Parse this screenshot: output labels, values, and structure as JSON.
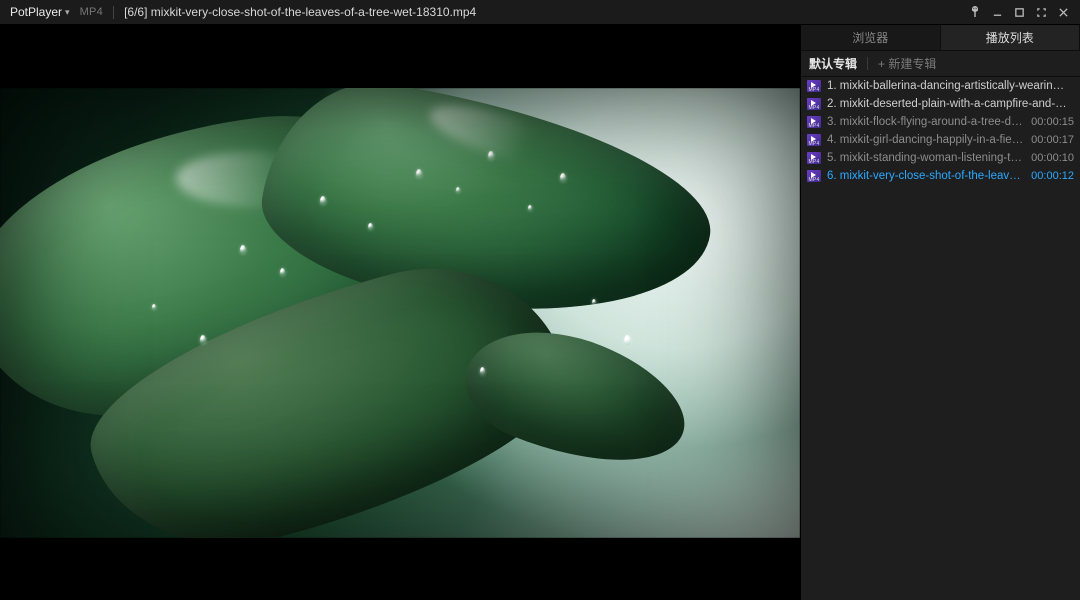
{
  "titlebar": {
    "app_name": "PotPlayer",
    "format_badge": "MP4",
    "file_title": "[6/6] mixkit-very-close-shot-of-the-leaves-of-a-tree-wet-18310.mp4"
  },
  "sidebar": {
    "tabs": {
      "browser": "浏览器",
      "playlist": "播放列表"
    },
    "album": {
      "default_label": "默认专辑",
      "new_label": "+ 新建专辑"
    },
    "items": [
      {
        "index": "1.",
        "name": "mixkit-ballerina-dancing-artistically-wearing-a-...",
        "duration": "",
        "style": "light"
      },
      {
        "index": "2.",
        "name": "mixkit-deserted-plain-with-a-campfire-and-a-w...",
        "duration": "",
        "style": "light"
      },
      {
        "index": "3.",
        "name": "mixkit-flock-flying-around-a-tree-durin...",
        "duration": "00:00:15",
        "style": "dim"
      },
      {
        "index": "4.",
        "name": "mixkit-girl-dancing-happily-in-a-field-...",
        "duration": "00:00:17",
        "style": "dim"
      },
      {
        "index": "5.",
        "name": "mixkit-standing-woman-listening-to-m...",
        "duration": "00:00:10",
        "style": "dim"
      },
      {
        "index": "6.",
        "name": "mixkit-very-close-shot-of-the-leaves-of...",
        "duration": "00:00:12",
        "style": "playing"
      }
    ]
  }
}
